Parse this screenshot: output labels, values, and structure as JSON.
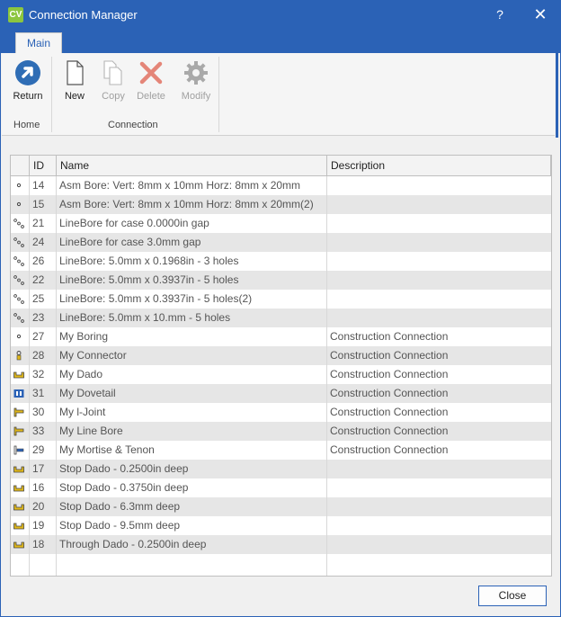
{
  "window": {
    "logo": "CV",
    "title": "Connection Manager",
    "help_label": "?",
    "close_label": "✕"
  },
  "ribbon": {
    "tab_label": "Main",
    "buttons": {
      "return": "Return",
      "new": "New",
      "copy": "Copy",
      "delete": "Delete",
      "modify": "Modify"
    },
    "groups": {
      "home": "Home",
      "connection": "Connection"
    }
  },
  "grid": {
    "columns": [
      "",
      "ID",
      "Name",
      "Description"
    ],
    "rows": [
      {
        "icon": "single-bore-icon",
        "id": "14",
        "name": "Asm Bore: Vert: 8mm x 10mm Horz: 8mm x 20mm",
        "description": ""
      },
      {
        "icon": "single-bore-icon",
        "id": "15",
        "name": "Asm Bore: Vert: 8mm x 10mm Horz: 8mm x 20mm(2)",
        "description": ""
      },
      {
        "icon": "line-bore-icon",
        "id": "21",
        "name": "LineBore for case 0.0000in gap",
        "description": ""
      },
      {
        "icon": "line-bore-icon",
        "id": "24",
        "name": "LineBore for case 3.0mm gap",
        "description": ""
      },
      {
        "icon": "line-bore-icon",
        "id": "26",
        "name": "LineBore: 5.0mm x 0.1968in - 3 holes",
        "description": ""
      },
      {
        "icon": "line-bore-icon",
        "id": "22",
        "name": "LineBore: 5.0mm x 0.3937in - 5 holes",
        "description": ""
      },
      {
        "icon": "line-bore-icon",
        "id": "25",
        "name": "LineBore: 5.0mm x 0.3937in - 5 holes(2)",
        "description": ""
      },
      {
        "icon": "line-bore-icon",
        "id": "23",
        "name": "LineBore: 5.0mm x 10.mm - 5 holes",
        "description": ""
      },
      {
        "icon": "single-bore-icon",
        "id": "27",
        "name": "My Boring",
        "description": "Construction Connection"
      },
      {
        "icon": "connector-icon",
        "id": "28",
        "name": "My Connector",
        "description": "Construction Connection"
      },
      {
        "icon": "dado-icon",
        "id": "32",
        "name": "My Dado",
        "description": "Construction Connection"
      },
      {
        "icon": "dovetail-icon",
        "id": "31",
        "name": "My Dovetail",
        "description": "Construction Connection"
      },
      {
        "icon": "l-joint-icon",
        "id": "30",
        "name": "My l-Joint",
        "description": "Construction Connection"
      },
      {
        "icon": "l-joint-icon",
        "id": "33",
        "name": "My Line Bore",
        "description": "Construction Connection"
      },
      {
        "icon": "mortise-tenon-icon",
        "id": "29",
        "name": "My Mortise & Tenon",
        "description": "Construction Connection"
      },
      {
        "icon": "dado-icon",
        "id": "17",
        "name": "Stop Dado - 0.2500in deep",
        "description": ""
      },
      {
        "icon": "dado-icon",
        "id": "16",
        "name": "Stop Dado - 0.3750in deep",
        "description": ""
      },
      {
        "icon": "dado-icon",
        "id": "20",
        "name": "Stop Dado - 6.3mm deep",
        "description": ""
      },
      {
        "icon": "dado-icon",
        "id": "19",
        "name": "Stop Dado - 9.5mm deep",
        "description": ""
      },
      {
        "icon": "dado-icon",
        "id": "18",
        "name": "Through Dado - 0.2500in deep",
        "description": ""
      }
    ]
  },
  "footer": {
    "close_button": "Close"
  },
  "colors": {
    "titlebar": "#2b62b6",
    "return_icon": "#2f6db5",
    "delete_icon": "#e06a5a",
    "icon_yellow": "#e0b81a",
    "icon_blue": "#2b62b6"
  }
}
